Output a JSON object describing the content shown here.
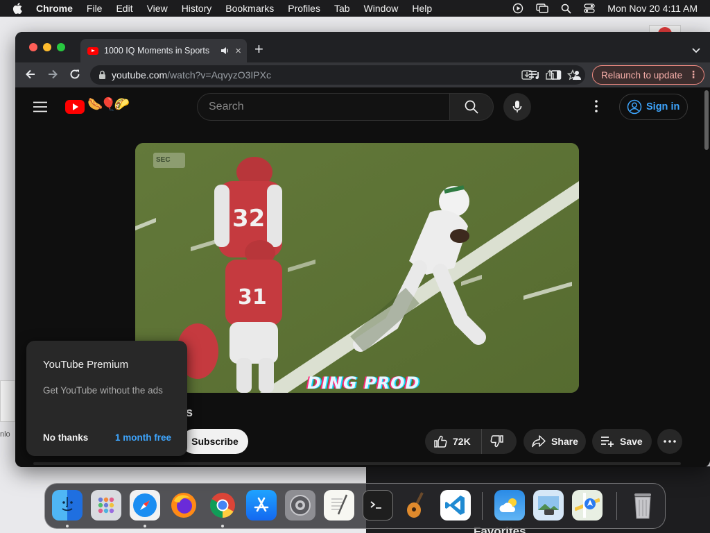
{
  "menubar": {
    "app": "Chrome",
    "items": [
      "File",
      "Edit",
      "View",
      "History",
      "Bookmarks",
      "Profiles",
      "Tab",
      "Window",
      "Help"
    ],
    "clock": "Mon Nov 20  4:11 AM",
    "status_icons": [
      "play-circle-icon",
      "screen-mirroring-icon",
      "spotlight-search-icon",
      "control-center-icon"
    ]
  },
  "browser": {
    "tab_title": "1000 IQ Moments in Sports",
    "tab_close": "×",
    "new_tab": "+",
    "url_host": "youtube.com",
    "url_path": "/watch?v=AqvyzO3IPXc",
    "relaunch_label": "Relaunch to update",
    "relaunch_menu": "⋮"
  },
  "youtube": {
    "search_placeholder": "Search",
    "signin_label": "Sign in",
    "doodle": "🌭🎈🌮",
    "video_overlay_text": "DING PROD",
    "channel_badge": "SEC",
    "title_fragment": "s",
    "subscribe_label": "Subscribe",
    "like_count": "72K",
    "share_label": "Share",
    "save_label": "Save"
  },
  "premium_popup": {
    "title": "YouTube Premium",
    "description": "Get YouTube without the ads",
    "decline_label": "No thanks",
    "trial_label": "1 month free"
  },
  "desktop": {
    "partial_label": "nlo",
    "favorites_label": "Favorites"
  },
  "dock": {
    "apps": [
      "Finder",
      "Launchpad",
      "Safari",
      "Firefox",
      "Google Chrome",
      "App Store",
      "System Settings",
      "TextEdit",
      "Terminal",
      "GarageBand",
      "Visual Studio Code",
      "Weather",
      "Preview",
      "Maps",
      "Trash"
    ]
  },
  "colors": {
    "youtube_red": "#ff0000",
    "link_blue": "#3ea6ff",
    "relaunch_accent": "#f28b82"
  }
}
